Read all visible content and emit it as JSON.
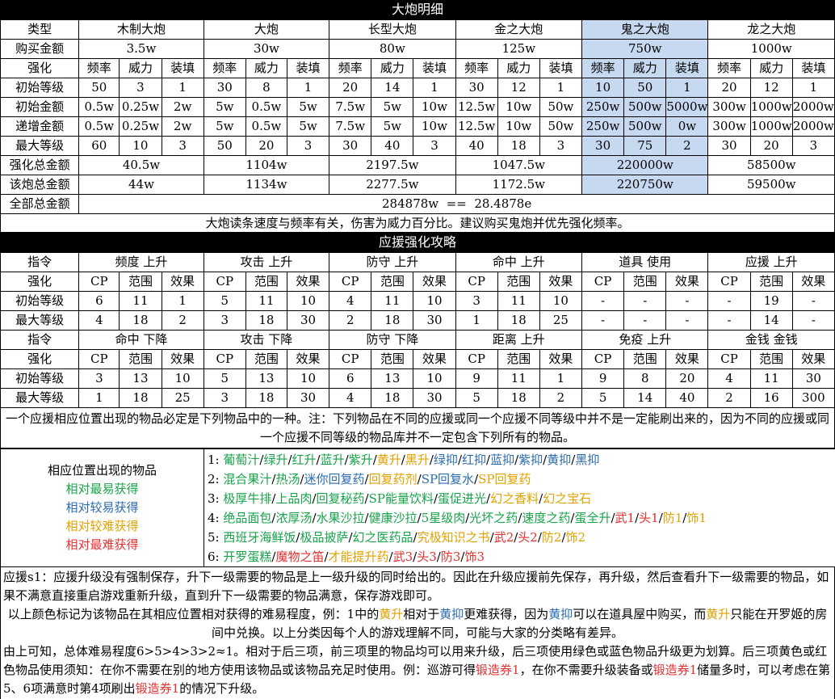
{
  "t1": {
    "title": "大炮明细",
    "row_type": "类型",
    "row_buy": "购买金额",
    "row_enh": "强化",
    "row_init_lv": "初始等级",
    "row_init_cost": "初始金额",
    "row_inc_cost": "递增金额",
    "row_max_lv": "最大等级",
    "row_enh_total": "强化总金额",
    "row_gun_total": "该炮总金额",
    "row_all_total": "全部总金额",
    "col_freq": "频率",
    "col_power": "威力",
    "col_load": "装填",
    "cannons": [
      {
        "name": "木制大炮",
        "buy": "3.5w",
        "init_lv": [
          "50",
          "3",
          "1"
        ],
        "init_cost": [
          "0.5w",
          "0.25w",
          "2w"
        ],
        "inc_cost": [
          "0.5w",
          "0.25w",
          "2w"
        ],
        "max_lv": [
          "60",
          "10",
          "3"
        ],
        "enh_total": "40.5w",
        "gun_total": "44w"
      },
      {
        "name": "大炮",
        "buy": "30w",
        "init_lv": [
          "30",
          "8",
          "1"
        ],
        "init_cost": [
          "5w",
          "0.5w",
          "5w"
        ],
        "inc_cost": [
          "5w",
          "0.5w",
          "5w"
        ],
        "max_lv": [
          "50",
          "20",
          "3"
        ],
        "enh_total": "1104w",
        "gun_total": "1134w"
      },
      {
        "name": "长型大炮",
        "buy": "80w",
        "init_lv": [
          "20",
          "14",
          "1"
        ],
        "init_cost": [
          "7.5w",
          "5w",
          "10w"
        ],
        "inc_cost": [
          "7.5w",
          "5w",
          "10w"
        ],
        "max_lv": [
          "30",
          "40",
          "3"
        ],
        "enh_total": "2197.5w",
        "gun_total": "2277.5w"
      },
      {
        "name": "金之大炮",
        "buy": "125w",
        "init_lv": [
          "30",
          "12",
          "1"
        ],
        "init_cost": [
          "12.5w",
          "10w",
          "50w"
        ],
        "inc_cost": [
          "12.5w",
          "10w",
          "50w"
        ],
        "max_lv": [
          "40",
          "18",
          "3"
        ],
        "enh_total": "1047.5w",
        "gun_total": "1172.5w"
      },
      {
        "name": "鬼之大炮",
        "buy": "750w",
        "init_lv": [
          "10",
          "50",
          "1"
        ],
        "init_cost": [
          "250w",
          "500w",
          "5000w"
        ],
        "inc_cost": [
          "250w",
          "500w",
          "0w"
        ],
        "max_lv": [
          "30",
          "75",
          "2"
        ],
        "enh_total": "220000w",
        "gun_total": "220750w"
      },
      {
        "name": "龙之大炮",
        "buy": "1000w",
        "init_lv": [
          "20",
          "12",
          "1"
        ],
        "init_cost": [
          "300w",
          "1000w",
          "2000w"
        ],
        "inc_cost": [
          "300w",
          "1000w",
          "2000w"
        ],
        "max_lv": [
          "30",
          "20",
          "3"
        ],
        "enh_total": "58500w",
        "gun_total": "59500w"
      }
    ],
    "all_total": "284878w  ==  28.4878e",
    "note": "大炮读条速度与频率有关，伤害为威力百分比。建议购买鬼炮并优先强化频率。"
  },
  "t2": {
    "title": "应援强化攻略",
    "row_cmd": "指令",
    "row_enh": "强化",
    "row_init": "初始等级",
    "row_max": "最大等级",
    "col_cp": "CP",
    "col_range": "范围",
    "col_effect": "效果",
    "group1": [
      {
        "name": "频度 上升",
        "init": [
          "6",
          "11",
          "1"
        ],
        "max": [
          "4",
          "18",
          "2"
        ]
      },
      {
        "name": "攻击 上升",
        "init": [
          "5",
          "11",
          "10"
        ],
        "max": [
          "3",
          "18",
          "30"
        ]
      },
      {
        "name": "防守 上升",
        "init": [
          "4",
          "11",
          "10"
        ],
        "max": [
          "2",
          "18",
          "30"
        ]
      },
      {
        "name": "命中 上升",
        "init": [
          "3",
          "11",
          "10"
        ],
        "max": [
          "1",
          "18",
          "25"
        ]
      },
      {
        "name": "道具 使用",
        "init": [
          "-",
          "-",
          "-"
        ],
        "max": [
          "-",
          "-",
          "-"
        ]
      },
      {
        "name": "应援 上升",
        "init": [
          "-",
          "19",
          "-"
        ],
        "max": [
          "-",
          "14",
          "-"
        ]
      }
    ],
    "group2": [
      {
        "name": "命中 下降",
        "init": [
          "3",
          "13",
          "10"
        ],
        "max": [
          "1",
          "18",
          "25"
        ]
      },
      {
        "name": "攻击 下降",
        "init": [
          "5",
          "13",
          "10"
        ],
        "max": [
          "3",
          "18",
          "30"
        ]
      },
      {
        "name": "防守 下降",
        "init": [
          "6",
          "13",
          "10"
        ],
        "max": [
          "4",
          "18",
          "30"
        ]
      },
      {
        "name": "距离 上升",
        "init": [
          "9",
          "11",
          "1"
        ],
        "max": [
          "5",
          "18",
          "2"
        ]
      },
      {
        "name": "免疫 上升",
        "init": [
          "9",
          "8",
          "20"
        ],
        "max": [
          "5",
          "14",
          "40"
        ]
      },
      {
        "name": "金钱 金钱",
        "init": [
          "4",
          "11",
          "30"
        ],
        "max": [
          "2",
          "16",
          "300"
        ]
      }
    ]
  },
  "items": {
    "intro": "一个应援相应位置出现的物品必定是下列物品中的一种。注：下列物品在不同的应援或同一个应援不同等级中并不是一定能刷出来的，因为不同的应援或同一个应援不同等级的物品库并不一定包含下列所有的物品。",
    "legend_title": "相应位置出现的物品",
    "legend": [
      "相对最易获得",
      "相对较易获得",
      "相对较难获得",
      "相对最难获得"
    ],
    "colors": {
      "green": "#17a34a",
      "blue": "#2b6cb0",
      "orange": "#e0a200",
      "red": "#e53030"
    },
    "rows": [
      {
        "num": "1:",
        "items": [
          {
            "t": "葡萄汁",
            "c": "green"
          },
          {
            "t": "/",
            "c": "black"
          },
          {
            "t": "绿升",
            "c": "green"
          },
          {
            "t": "/",
            "c": "black"
          },
          {
            "t": "红升",
            "c": "green"
          },
          {
            "t": "/",
            "c": "black"
          },
          {
            "t": "蓝升",
            "c": "green"
          },
          {
            "t": "/",
            "c": "black"
          },
          {
            "t": "紫升",
            "c": "green"
          },
          {
            "t": "/",
            "c": "black"
          },
          {
            "t": "黄升",
            "c": "orange"
          },
          {
            "t": "/",
            "c": "black"
          },
          {
            "t": "黑升",
            "c": "orange"
          },
          {
            "t": "/",
            "c": "black"
          },
          {
            "t": "绿抑",
            "c": "blue"
          },
          {
            "t": "/",
            "c": "black"
          },
          {
            "t": "红抑",
            "c": "blue"
          },
          {
            "t": "/",
            "c": "black"
          },
          {
            "t": "蓝抑",
            "c": "blue"
          },
          {
            "t": "/",
            "c": "black"
          },
          {
            "t": "紫抑",
            "c": "blue"
          },
          {
            "t": "/",
            "c": "black"
          },
          {
            "t": "黄抑",
            "c": "blue"
          },
          {
            "t": "/",
            "c": "black"
          },
          {
            "t": "黑抑",
            "c": "blue"
          }
        ]
      },
      {
        "num": "2:",
        "items": [
          {
            "t": "混合果汁",
            "c": "green"
          },
          {
            "t": "/",
            "c": "black"
          },
          {
            "t": "热汤",
            "c": "green"
          },
          {
            "t": "/",
            "c": "black"
          },
          {
            "t": "迷你回复药",
            "c": "blue"
          },
          {
            "t": "/",
            "c": "black"
          },
          {
            "t": "回复药剂",
            "c": "orange"
          },
          {
            "t": "/",
            "c": "black"
          },
          {
            "t": "SP回复水",
            "c": "blue"
          },
          {
            "t": "/",
            "c": "black"
          },
          {
            "t": "SP回复药",
            "c": "orange"
          }
        ]
      },
      {
        "num": "3:",
        "items": [
          {
            "t": "极厚牛排",
            "c": "green"
          },
          {
            "t": "/",
            "c": "black"
          },
          {
            "t": "上品肉",
            "c": "green"
          },
          {
            "t": "/",
            "c": "black"
          },
          {
            "t": "回复秘药",
            "c": "green"
          },
          {
            "t": "/",
            "c": "black"
          },
          {
            "t": "SP能量饮料",
            "c": "green"
          },
          {
            "t": "/",
            "c": "black"
          },
          {
            "t": "蛋促进光",
            "c": "green"
          },
          {
            "t": "/",
            "c": "black"
          },
          {
            "t": "幻之香料",
            "c": "orange"
          },
          {
            "t": "/",
            "c": "black"
          },
          {
            "t": "幻之宝石",
            "c": "orange"
          }
        ]
      },
      {
        "num": "4:",
        "items": [
          {
            "t": "绝品面包",
            "c": "green"
          },
          {
            "t": "/",
            "c": "black"
          },
          {
            "t": "浓厚汤",
            "c": "green"
          },
          {
            "t": "/",
            "c": "black"
          },
          {
            "t": "水果沙拉",
            "c": "green"
          },
          {
            "t": "/",
            "c": "black"
          },
          {
            "t": "健康沙拉",
            "c": "green"
          },
          {
            "t": "/",
            "c": "black"
          },
          {
            "t": "5星级肉",
            "c": "green"
          },
          {
            "t": "/",
            "c": "black"
          },
          {
            "t": "光坏之药",
            "c": "green"
          },
          {
            "t": "/",
            "c": "black"
          },
          {
            "t": "速度之药",
            "c": "green"
          },
          {
            "t": "/",
            "c": "black"
          },
          {
            "t": "蛋全升",
            "c": "green"
          },
          {
            "t": "/",
            "c": "black"
          },
          {
            "t": "武1",
            "c": "red"
          },
          {
            "t": "/",
            "c": "black"
          },
          {
            "t": "头1",
            "c": "red"
          },
          {
            "t": "/",
            "c": "black"
          },
          {
            "t": "防1",
            "c": "orange"
          },
          {
            "t": "/",
            "c": "black"
          },
          {
            "t": "饰1",
            "c": "orange"
          }
        ]
      },
      {
        "num": "5:",
        "items": [
          {
            "t": "西班牙海鲜饭",
            "c": "green"
          },
          {
            "t": "/",
            "c": "black"
          },
          {
            "t": "极品披萨",
            "c": "green"
          },
          {
            "t": "/",
            "c": "black"
          },
          {
            "t": "幻之医药品",
            "c": "green"
          },
          {
            "t": "/",
            "c": "black"
          },
          {
            "t": "究极知识之书",
            "c": "orange"
          },
          {
            "t": "/",
            "c": "black"
          },
          {
            "t": "武2",
            "c": "red"
          },
          {
            "t": "/",
            "c": "black"
          },
          {
            "t": "头2",
            "c": "red"
          },
          {
            "t": "/",
            "c": "black"
          },
          {
            "t": "防2",
            "c": "orange"
          },
          {
            "t": "/",
            "c": "black"
          },
          {
            "t": "饰2",
            "c": "orange"
          }
        ]
      },
      {
        "num": "6:",
        "items": [
          {
            "t": "开罗蛋糕",
            "c": "green"
          },
          {
            "t": "/",
            "c": "black"
          },
          {
            "t": "魔物之笛",
            "c": "red"
          },
          {
            "t": "/",
            "c": "black"
          },
          {
            "t": "才能提升药",
            "c": "orange"
          },
          {
            "t": "/",
            "c": "black"
          },
          {
            "t": "武3",
            "c": "red"
          },
          {
            "t": "/",
            "c": "black"
          },
          {
            "t": "头3",
            "c": "red"
          },
          {
            "t": "/",
            "c": "black"
          },
          {
            "t": "防3",
            "c": "red"
          },
          {
            "t": "/",
            "c": "black"
          },
          {
            "t": "饰3",
            "c": "red"
          }
        ]
      }
    ]
  },
  "desc": {
    "p1": [
      {
        "t": "应援s1：应援升级没有强制保存，升下一级需要的物品是上一级升级的同时给出的。因此在升级应援前先保存，再升级，然后查看升下一级需要的物品，如果不满意直接重启游戏重新升级，直到升下一级需要的物品满意，保存游戏即可。",
        "c": "black"
      }
    ],
    "p2": [
      {
        "t": "以上颜色标记为该物品在其相应位置相对获得的难易程度，例：1中的",
        "c": "black"
      },
      {
        "t": "黄升",
        "c": "orange"
      },
      {
        "t": "相对于",
        "c": "black"
      },
      {
        "t": "黄抑",
        "c": "blue"
      },
      {
        "t": "更难获得，因为",
        "c": "black"
      },
      {
        "t": "黄抑",
        "c": "blue"
      },
      {
        "t": "可以在道具屋中购买，而",
        "c": "black"
      },
      {
        "t": "黄升",
        "c": "orange"
      },
      {
        "t": "只能在开罗姬的房间中兑换。以上分类因每个人的游戏理解不同，可能与大家的分类略有差异。",
        "c": "black"
      }
    ],
    "p3": [
      {
        "t": "由上可知，总体难易程度6>5>4>3>2≈1。相对于后三项，前三项里的物品均可以用来升级，后三项使用绿色或蓝色物品升级更为划算。后三项黄色或红色物品使用须知：在你不需要在别的地方使用该物品或该物品充足时使用。例：巡游可得",
        "c": "black"
      },
      {
        "t": "锻造券1",
        "c": "red"
      },
      {
        "t": "，在你不需要升级装备或",
        "c": "black"
      },
      {
        "t": "锻造券1",
        "c": "red"
      },
      {
        "t": "储量多时，可以考虑在第5、6项满意时第4项刷出",
        "c": "black"
      },
      {
        "t": "锻造券1",
        "c": "red"
      },
      {
        "t": "的情况下升级。",
        "c": "black"
      }
    ]
  }
}
